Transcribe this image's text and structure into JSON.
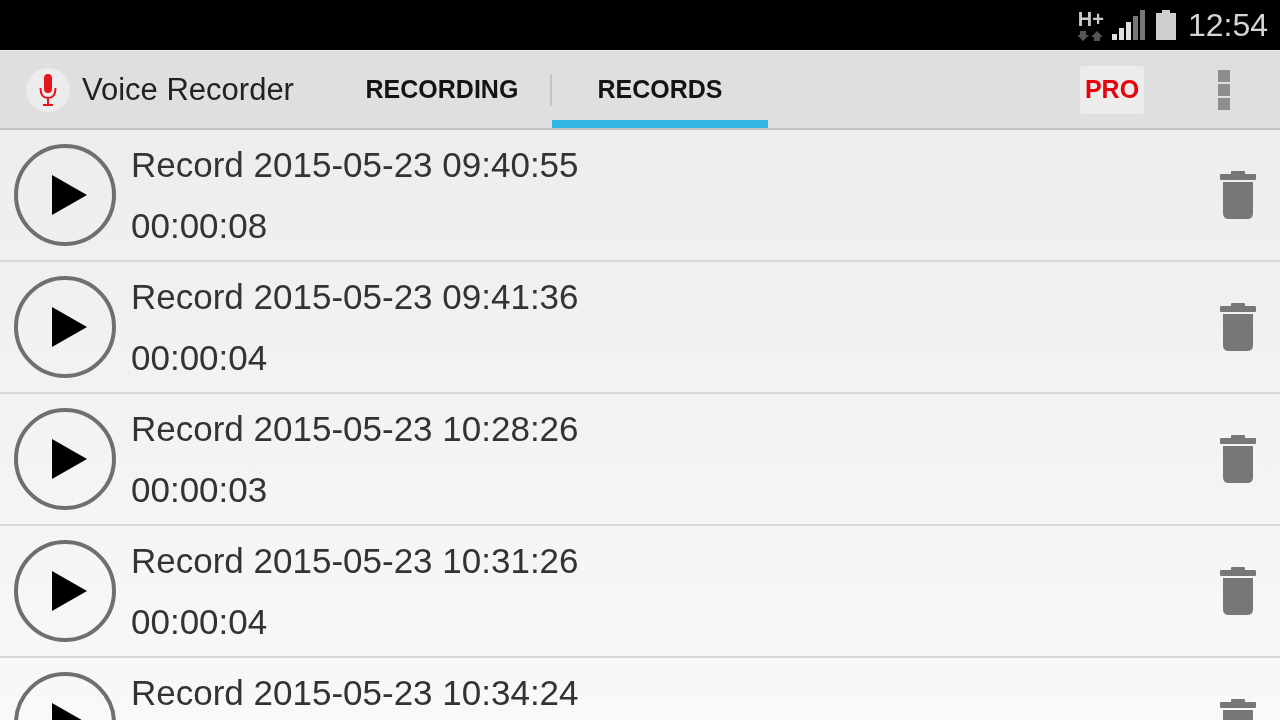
{
  "status_bar": {
    "network": "H+",
    "time": "12:54"
  },
  "app_bar": {
    "title": "Voice Recorder",
    "tabs": [
      {
        "label": "RECORDING",
        "selected": false
      },
      {
        "label": "RECORDS",
        "selected": true
      }
    ],
    "pro_button": "PRO"
  },
  "records": [
    {
      "name": "Record 2015-05-23 09:40:55",
      "duration": "00:00:08"
    },
    {
      "name": "Record 2015-05-23 09:41:36",
      "duration": "00:00:04"
    },
    {
      "name": "Record 2015-05-23 10:28:26",
      "duration": "00:00:03"
    },
    {
      "name": "Record 2015-05-23 10:31:26",
      "duration": "00:00:04"
    },
    {
      "name": "Record 2015-05-23 10:34:24"
    }
  ]
}
